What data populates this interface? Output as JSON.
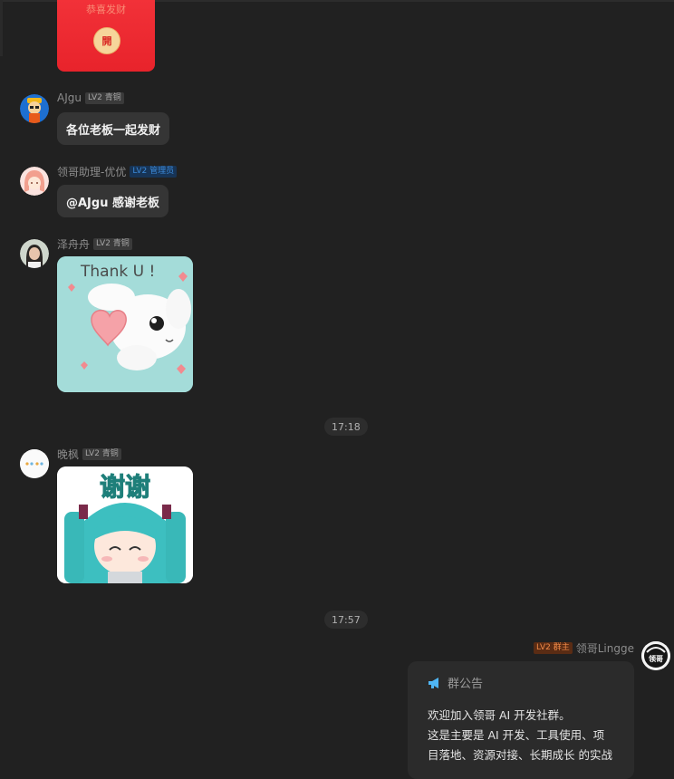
{
  "red_packet": {
    "caption": "恭喜发财",
    "open_label": "開"
  },
  "messages": [
    {
      "name": "AJgu",
      "badge": "LV2 青铜",
      "text": "各位老板一起发财"
    },
    {
      "name": "领哥助理-优优",
      "badge": "LV2 管理员",
      "text": "@AJgu 感谢老板"
    },
    {
      "name": "泽舟舟",
      "badge": "LV2 青铜",
      "sticker_text": "Thank U !"
    },
    {
      "name": "晚枫",
      "badge": "LV2 青铜",
      "sticker_text": "谢谢"
    }
  ],
  "timestamps": [
    "17:18",
    "17:57"
  ],
  "owner": {
    "badge": "LV2 群主",
    "name": "领哥Lingge",
    "avatar_text": "领哥"
  },
  "notice": {
    "title": "群公告",
    "lines": [
      "欢迎加入领哥 AI 开发社群。",
      "这是主要是 AI 开发、工具使用、项",
      "目落地、资源对接、长期成长 的实战"
    ]
  },
  "colors": {
    "background": "#212121",
    "bubble": "#353535",
    "red_packet": "#e8232b",
    "admin_badge": "#3c8ad8",
    "owner_badge": "#f08a48",
    "notice_icon": "#4fb6f5"
  }
}
